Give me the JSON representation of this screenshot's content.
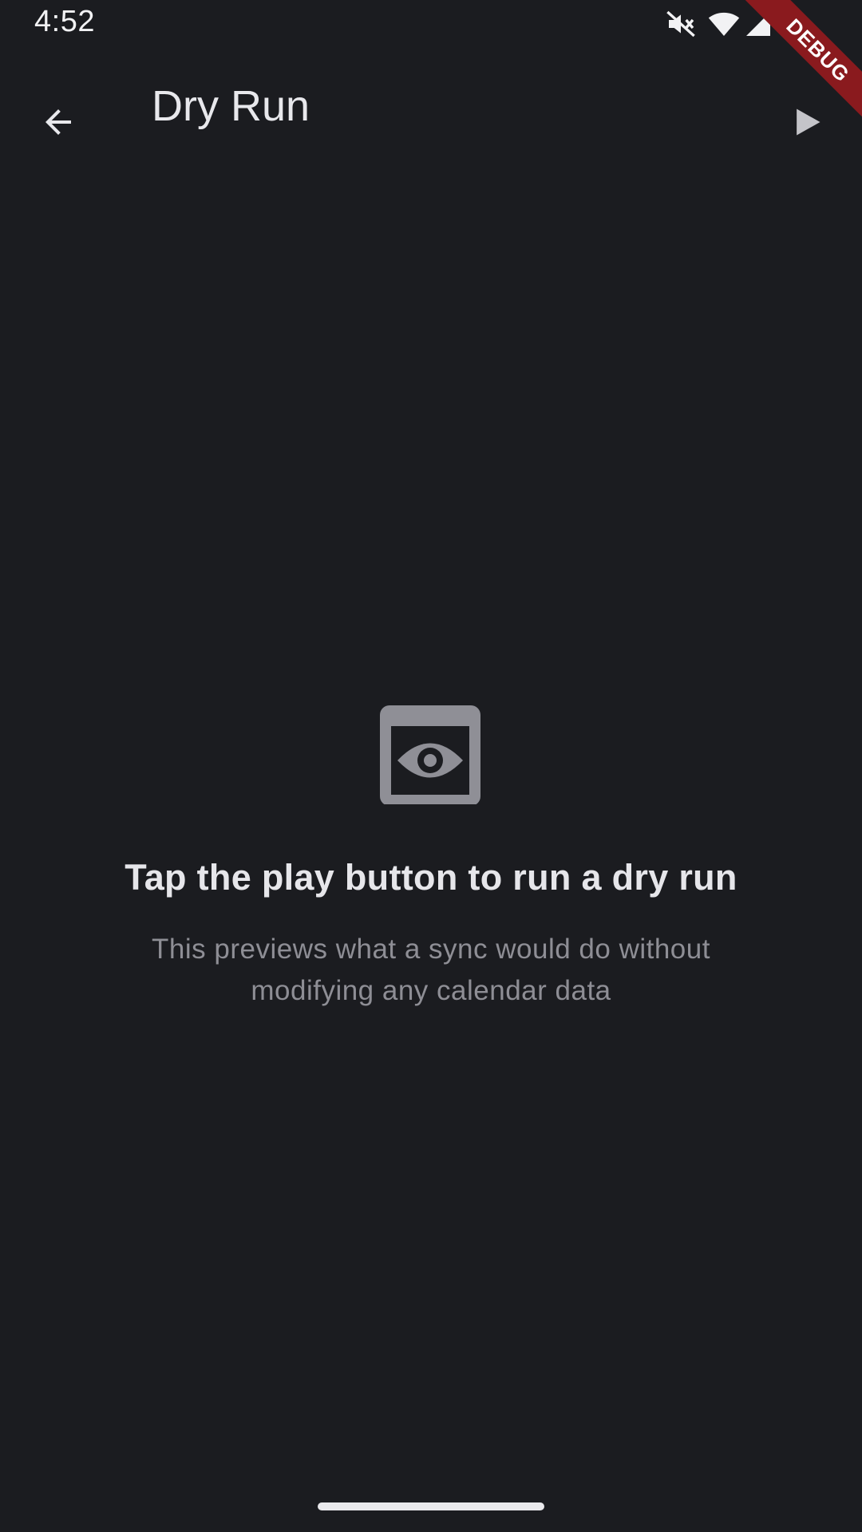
{
  "status_bar": {
    "time": "4:52",
    "icons": [
      "mute-icon",
      "wifi-icon",
      "signal-icon",
      "battery-icon"
    ]
  },
  "debug_banner": "DEBUG",
  "app_bar": {
    "back_icon": "arrow-back-icon",
    "title": "Dry Run",
    "action_icon": "play-icon"
  },
  "empty_state": {
    "icon": "preview-eye-icon",
    "title": "Tap the play button to run a dry run",
    "subtitle": "This previews what a sync would do without modifying any calendar data"
  },
  "colors": {
    "background": "#1b1c20",
    "text_primary": "#e6e6ea",
    "text_secondary": "#8e8e95",
    "icon_muted": "#8f8f96",
    "debug_ribbon": "#8a1a1e"
  }
}
